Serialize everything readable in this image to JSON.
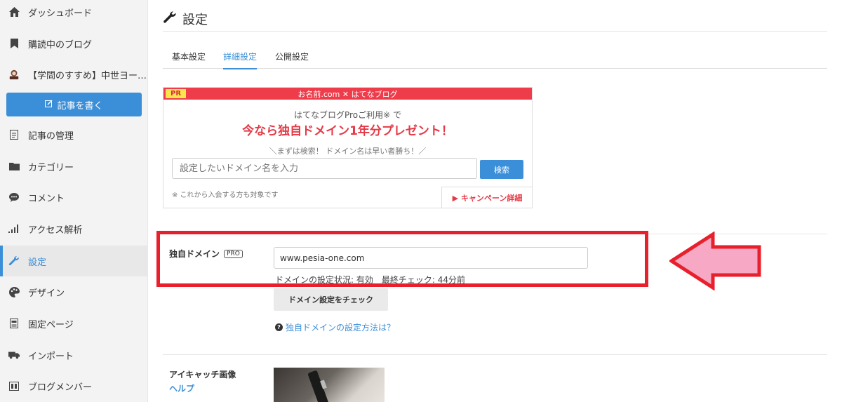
{
  "sidebar": {
    "items": [
      {
        "label": "ダッシュボード",
        "icon": "home-icon"
      },
      {
        "label": "購読中のブログ",
        "icon": "bookmark-icon"
      },
      {
        "label": "【学問のすすめ】中世ヨー…",
        "icon": "blog-avatar-icon"
      },
      {
        "label": "記事の管理",
        "icon": "document-icon"
      },
      {
        "label": "カテゴリー",
        "icon": "folder-icon"
      },
      {
        "label": "コメント",
        "icon": "comment-icon"
      },
      {
        "label": "アクセス解析",
        "icon": "bar-chart-icon"
      },
      {
        "label": "設定",
        "icon": "wrench-icon",
        "active": true
      },
      {
        "label": "デザイン",
        "icon": "palette-icon"
      },
      {
        "label": "固定ページ",
        "icon": "page-icon"
      },
      {
        "label": "インポート",
        "icon": "truck-icon"
      },
      {
        "label": "ブログメンバー",
        "icon": "members-icon"
      }
    ],
    "write_button": "記事を書く"
  },
  "page": {
    "title": "設定"
  },
  "tabs": [
    {
      "label": "基本設定"
    },
    {
      "label": "詳細設定",
      "active": true
    },
    {
      "label": "公開設定"
    }
  ],
  "ad": {
    "pr": "PR",
    "header": "お名前.com ✕ はてなブログ",
    "sub": "はてなブログProご利用※ で",
    "headline": "今なら独自ドメイン1年分プレゼント！",
    "tagline": "＼まずは検索！ ドメイン名は早い者勝ち！／",
    "placeholder": "設定したいドメイン名を入力",
    "search_button": "検索",
    "note": "※ これから入会する方も対象です",
    "campaign": "▶ キャンペーン詳細"
  },
  "domain": {
    "label": "独自ドメイン",
    "pro_badge": "PRO",
    "value": "www.pesia-one.com",
    "status": "ドメインの設定状況: 有効　最終チェック: 44分前",
    "check_button": "ドメイン設定をチェック",
    "help_link": "独自ドメインの設定方法は？"
  },
  "eyecatch": {
    "label": "アイキャッチ画像",
    "help": "ヘルプ"
  },
  "colors": {
    "accent": "#3b8fd8",
    "highlight": "#e8202c",
    "arrow_fill": "#f7a8c4",
    "ad_red": "#ef3c4a"
  }
}
